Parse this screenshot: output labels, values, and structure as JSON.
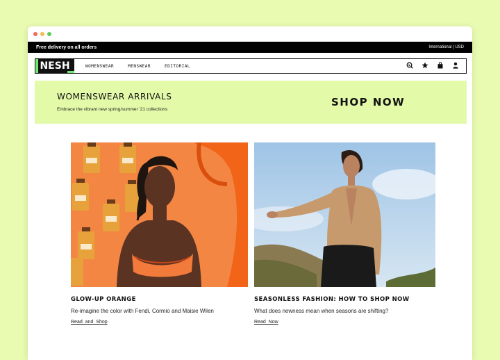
{
  "promo_bar": {
    "delivery_text": "Free delivery on all orders",
    "region_text": "International | USD"
  },
  "nav": {
    "logo": "NESH",
    "items": [
      {
        "label": "WOMENSWEAR"
      },
      {
        "label": "MENSWEAR"
      },
      {
        "label": "EDITORIAL"
      }
    ],
    "icons": [
      "search-icon",
      "star-icon",
      "bag-icon",
      "user-icon"
    ]
  },
  "banner": {
    "title": "WOMENSWEAR ARRIVALS",
    "subtitle": "Embrace the vibrant new spring/summer '21 collections",
    "cta": "SHOP NOW",
    "bg_color": "#e3faa9"
  },
  "cards": [
    {
      "title": "GLOW-UP ORANGE",
      "description": "Re-imagine the color with Fendi, Cormio and Maisie Wilen",
      "link": "Read and Shop"
    },
    {
      "title": "SEASONLESS FASHION: HOW TO SHOP NOW",
      "description": "What does newness mean when seasons are shifting?",
      "link": "Read Now"
    }
  ],
  "colors": {
    "page_bg": "#e9fbb0",
    "accent_green": "#6ee86e"
  }
}
